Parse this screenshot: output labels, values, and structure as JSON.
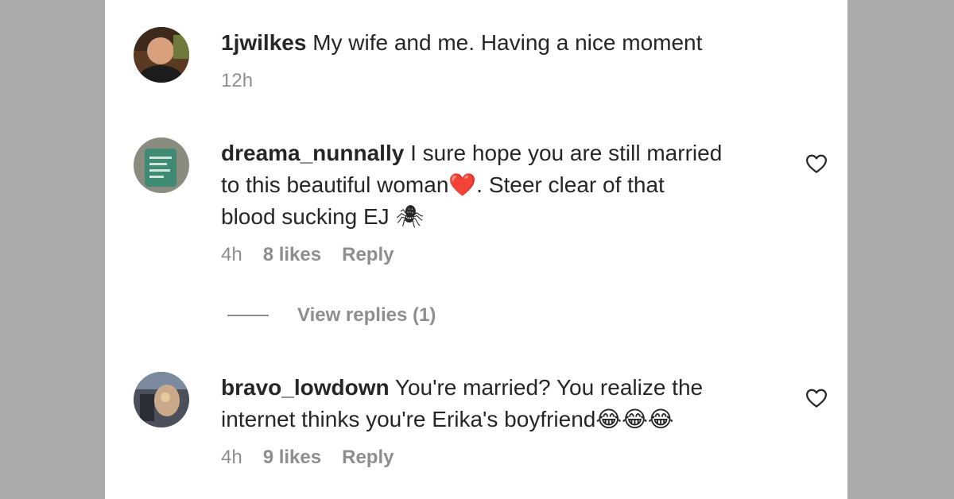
{
  "comments": [
    {
      "username": "1jwilkes",
      "text": "My wife and me. Having a nice moment",
      "time": "12h"
    },
    {
      "username": "dreama_nunnally",
      "text_line1": "I sure hope you are still married",
      "text_line2_before": "to this beautiful woman",
      "text_line2_emoji": "❤️",
      "text_line2_after": ". Steer clear of that",
      "text_line3": "blood sucking EJ",
      "text_line3_emoji": "🕷",
      "time": "4h",
      "likes": "8 likes",
      "reply": "Reply",
      "view_replies": "View replies (1)",
      "heart_icon": "heart-outline-icon"
    },
    {
      "username": "bravo_lowdown",
      "text_line1": "You're married? You realize the",
      "text_line2": "internet thinks you're Erika's boyfriend",
      "text_line2_emoji": "😂😂😂",
      "time": "4h",
      "likes": "9 likes",
      "reply": "Reply",
      "heart_icon": "heart-outline-icon"
    }
  ],
  "colors": {
    "background": "#ababab",
    "panel": "#ffffff",
    "text": "#262626",
    "muted": "#8e8e8e",
    "heart_red": "#e0202b"
  }
}
